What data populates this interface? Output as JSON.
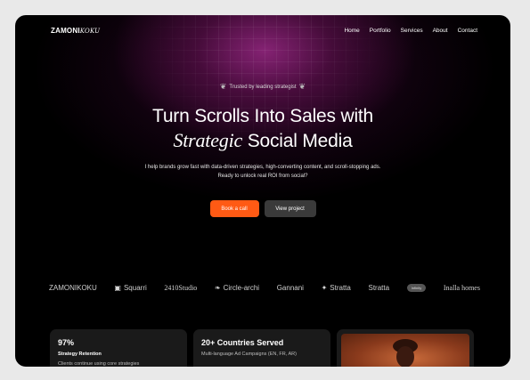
{
  "nav": {
    "logo_main": "ZAMONI",
    "logo_ital": "KOKU",
    "items": [
      {
        "label": "Home"
      },
      {
        "label": "Portfolio"
      },
      {
        "label": "Services"
      },
      {
        "label": "About"
      },
      {
        "label": "Contact"
      }
    ]
  },
  "hero": {
    "badge": "Trusted by leading strategist",
    "title_line1": "Turn Scrolls Into Sales with",
    "title_serif": "Strategic",
    "title_rest": "Social Media",
    "subtitle": "I help brands grow fast with data-driven strategies, high-converting content, and scroll-stopping ads. Ready to unlock real ROI from social?",
    "primary_button": "Book a call",
    "secondary_button": "View project"
  },
  "brands": [
    {
      "name": "ZAMONIKOKU"
    },
    {
      "name": "Squarri"
    },
    {
      "name": "2410Studio"
    },
    {
      "name": "Circle-archi"
    },
    {
      "name": "Gannani"
    },
    {
      "name": "Stratta"
    },
    {
      "name": "Stratta"
    },
    {
      "name": "Infinity"
    },
    {
      "name": "Inalla homes"
    }
  ],
  "cards": [
    {
      "big": "97%",
      "title": "Strategy Retention",
      "text": "Clients continue using core strategies"
    },
    {
      "big": "20+ Countries Served",
      "title": "",
      "text": "Multi-language Ad Campaigns (EN, FR, AR)"
    }
  ],
  "colors": {
    "accent": "#ff5a14",
    "background": "#000000",
    "glow": "#96288a"
  }
}
